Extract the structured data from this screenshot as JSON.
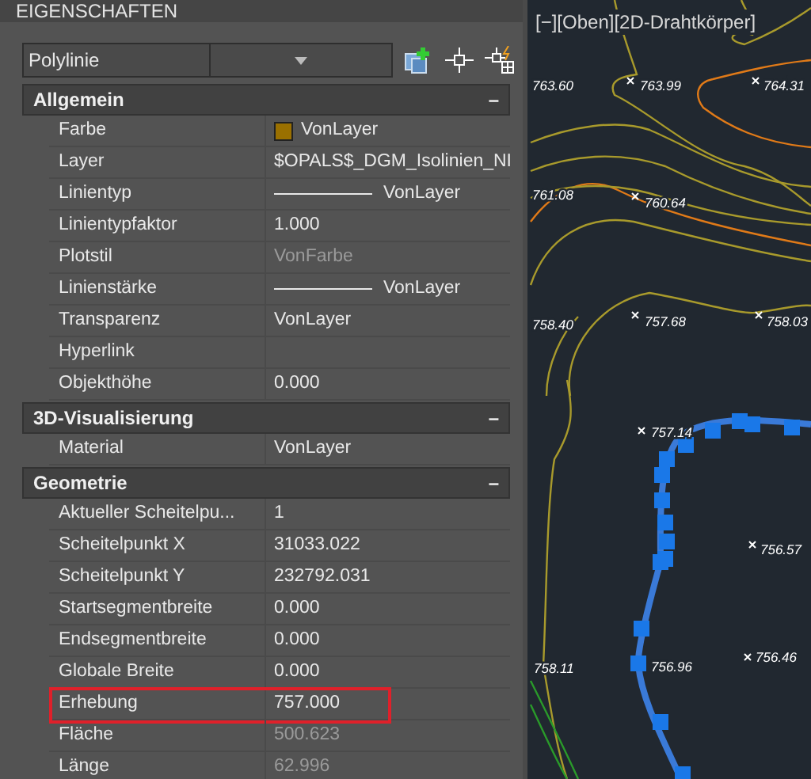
{
  "panel": {
    "title": "EIGENSCHAFTEN"
  },
  "selector": {
    "value": "Polylinie"
  },
  "sections": [
    {
      "title": "Allgemein",
      "expander": "–",
      "rows": [
        {
          "label": "Farbe",
          "value": "VonLayer",
          "kind": "color",
          "color": "#9a7000",
          "disabled": false,
          "highlighted": false
        },
        {
          "label": "Layer",
          "value": "$OPALS$_DGM_Isolinien_NI",
          "kind": "text",
          "disabled": false,
          "highlighted": false
        },
        {
          "label": "Linientyp",
          "value": "VonLayer",
          "kind": "line",
          "disabled": false,
          "highlighted": false
        },
        {
          "label": "Linientypfaktor",
          "value": "1.000",
          "kind": "text",
          "disabled": false,
          "highlighted": false
        },
        {
          "label": "Plotstil",
          "value": "VonFarbe",
          "kind": "text",
          "disabled": true,
          "highlighted": false
        },
        {
          "label": "Linienstärke",
          "value": "VonLayer",
          "kind": "line",
          "disabled": false,
          "highlighted": false
        },
        {
          "label": "Transparenz",
          "value": "VonLayer",
          "kind": "text",
          "disabled": false,
          "highlighted": false
        },
        {
          "label": "Hyperlink",
          "kind": "text",
          "highlighted": false
        },
        {
          "label": "Objekthöhe",
          "value": "0.000",
          "kind": "text",
          "disabled": false,
          "highlighted": false
        }
      ]
    },
    {
      "title": "3D-Visualisierung",
      "expander": "–",
      "rows": [
        {
          "label": "Material",
          "value": "VonLayer",
          "kind": "text",
          "disabled": false,
          "highlighted": false
        }
      ]
    },
    {
      "title": "Geometrie",
      "expander": "–",
      "rows": [
        {
          "label": "Aktueller  Scheitelpu...",
          "value": "1",
          "kind": "text",
          "disabled": false,
          "highlighted": false
        },
        {
          "label": "Scheitelpunkt X",
          "value": "31033.022",
          "kind": "text",
          "disabled": false,
          "highlighted": false
        },
        {
          "label": "Scheitelpunkt Y",
          "value": "232792.031",
          "kind": "text",
          "disabled": false,
          "highlighted": false
        },
        {
          "label": "Startsegmentbreite",
          "value": "0.000",
          "kind": "text",
          "disabled": false,
          "highlighted": false
        },
        {
          "label": "Endsegmentbreite",
          "value": "0.000",
          "kind": "text",
          "disabled": false,
          "highlighted": false
        },
        {
          "label": "Globale Breite",
          "value": "0.000",
          "kind": "text",
          "disabled": false,
          "highlighted": false
        },
        {
          "label": "Erhebung",
          "value": "757.000",
          "kind": "text",
          "disabled": false,
          "highlighted": true
        },
        {
          "label": "Fläche",
          "value": "500.623",
          "kind": "text",
          "disabled": true,
          "highlighted": false
        },
        {
          "label": "Länge",
          "value": "62.996",
          "kind": "text",
          "disabled": true,
          "highlighted": false
        }
      ]
    }
  ],
  "viewport": {
    "title": "[−][Oben][2D-Drahtkörper]",
    "spot_heights": [
      "763.60",
      "763.99",
      "764.31",
      "761.08",
      "760.64",
      "758.40",
      "757.68",
      "758.03",
      "757.14",
      "756.57",
      "756.96",
      "756.46",
      "758.11"
    ]
  }
}
